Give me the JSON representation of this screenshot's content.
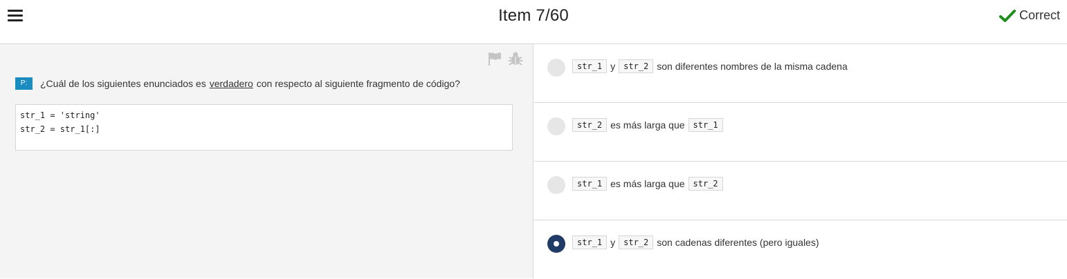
{
  "header": {
    "title": "Item 7/60",
    "status_label": "Correct",
    "status_color": "#1e8f1e",
    "menu_icon": "hamburger-menu-icon",
    "status_icon": "checkmark-icon"
  },
  "question": {
    "badge": "P:",
    "text_before": "¿Cuál de los siguientes enunciados es",
    "text_underlined": "verdadero",
    "text_after": "con respecto al siguiente fragmento de código?",
    "code_lines": [
      "str_1 = 'string'",
      "str_2 = str_1[:]"
    ],
    "tools": [
      "flag-icon",
      "bug-icon"
    ]
  },
  "options": [
    {
      "selected": false,
      "parts": [
        {
          "type": "code",
          "text": "str_1"
        },
        {
          "type": "text",
          "text": "y"
        },
        {
          "type": "code",
          "text": "str_2"
        },
        {
          "type": "text",
          "text": "son diferentes nombres de la misma cadena"
        }
      ]
    },
    {
      "selected": false,
      "parts": [
        {
          "type": "code",
          "text": "str_2"
        },
        {
          "type": "text",
          "text": "es más larga que"
        },
        {
          "type": "code",
          "text": "str_1"
        }
      ]
    },
    {
      "selected": false,
      "parts": [
        {
          "type": "code",
          "text": "str_1"
        },
        {
          "type": "text",
          "text": "es más larga que"
        },
        {
          "type": "code",
          "text": "str_2"
        }
      ]
    },
    {
      "selected": true,
      "parts": [
        {
          "type": "code",
          "text": "str_1"
        },
        {
          "type": "text",
          "text": "y"
        },
        {
          "type": "code",
          "text": "str_2"
        },
        {
          "type": "text",
          "text": "son cadenas diferentes (pero iguales)"
        }
      ]
    }
  ],
  "colors": {
    "badge": "#1a8cbf",
    "radio_selected": "#1f3b66",
    "radio_unselected": "#e6e6e6",
    "left_panel_bg": "#f4f4f4"
  }
}
